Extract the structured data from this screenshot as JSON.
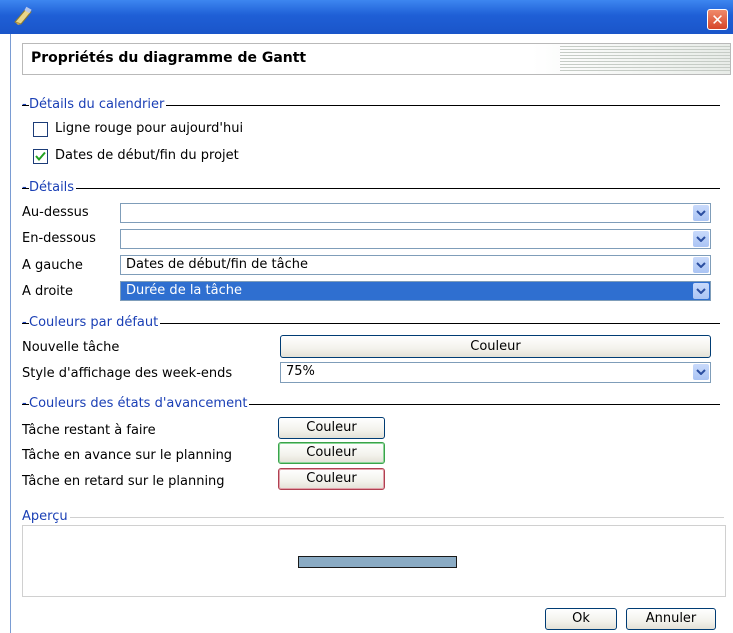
{
  "dialog": {
    "header_title": "Propriétés du diagramme de Gantt",
    "close_glyph": "✕",
    "colors": {
      "titlebar": "#2563d9",
      "section_title": "#1a3fb5",
      "selected_row": "#2f6fd0",
      "preview_bar": "#8aabc4",
      "advance_border": "#3aa34a",
      "late_border": "#b04050"
    }
  },
  "calendar": {
    "title": "Détails du calendrier",
    "today_line": {
      "label": "Ligne rouge pour aujourd'hui",
      "checked": false
    },
    "project_dates": {
      "label": "Dates de début/fin du projet",
      "checked": true
    }
  },
  "details": {
    "title": "Détails",
    "above": {
      "label": "Au-dessus",
      "value": ""
    },
    "below": {
      "label": "En-dessous",
      "value": ""
    },
    "left": {
      "label": "A gauche",
      "value": "Dates de début/fin de tâche"
    },
    "right": {
      "label": "A droite",
      "value": "Durée de la tâche"
    }
  },
  "default_colors": {
    "title": "Couleurs par défaut",
    "new_task": {
      "label": "Nouvelle tâche",
      "button": "Couleur"
    },
    "weekend_style": {
      "label": "Style d'affichage des week-ends",
      "value": "75%"
    }
  },
  "progress_colors": {
    "title": "Couleurs des états d'avancement",
    "remaining": {
      "label": "Tâche restant à faire",
      "button": "Couleur"
    },
    "ahead": {
      "label": "Tâche en avance sur le planning",
      "button": "Couleur"
    },
    "late": {
      "label": "Tâche en retard sur le planning",
      "button": "Couleur"
    }
  },
  "preview": {
    "title": "Aperçu"
  },
  "buttons": {
    "ok": "Ok",
    "cancel": "Annuler"
  }
}
